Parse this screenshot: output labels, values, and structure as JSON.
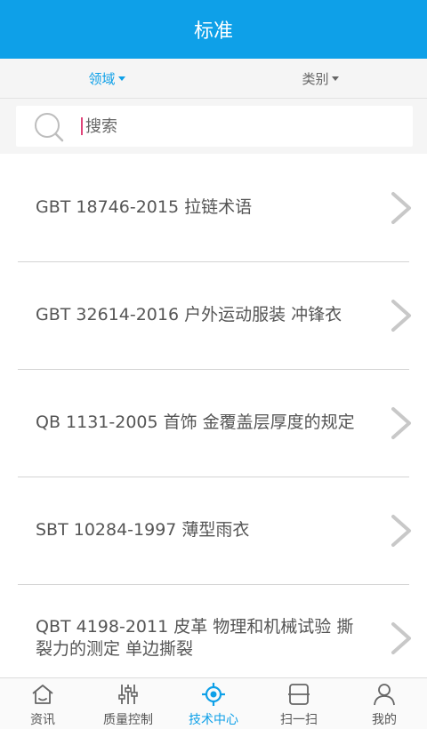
{
  "header": {
    "title": "标准"
  },
  "filters": [
    {
      "label": "领域",
      "active": true
    },
    {
      "label": "类别",
      "active": false
    }
  ],
  "search": {
    "placeholder": "搜索",
    "value": ""
  },
  "standards": [
    {
      "title": "GBT 18746-2015 拉链术语"
    },
    {
      "title": "GBT 32614-2016 户外运动服装 冲锋衣"
    },
    {
      "title": "QB 1131-2005 首饰 金覆盖层厚度的规定"
    },
    {
      "title": "SBT 10284-1997 薄型雨衣"
    },
    {
      "title": "QBT 4198-2011 皮革 物理和机械试验 撕裂力的测定 单边撕裂"
    }
  ],
  "tabs": [
    {
      "label": "资讯",
      "icon": "home-icon",
      "active": false
    },
    {
      "label": "质量控制",
      "icon": "sliders-icon",
      "active": false
    },
    {
      "label": "技术中心",
      "icon": "target-icon",
      "active": true
    },
    {
      "label": "扫一扫",
      "icon": "scan-icon",
      "active": false
    },
    {
      "label": "我的",
      "icon": "user-icon",
      "active": false
    }
  ],
  "colors": {
    "accent": "#0ea0e8",
    "cursor": "#e0457a"
  }
}
